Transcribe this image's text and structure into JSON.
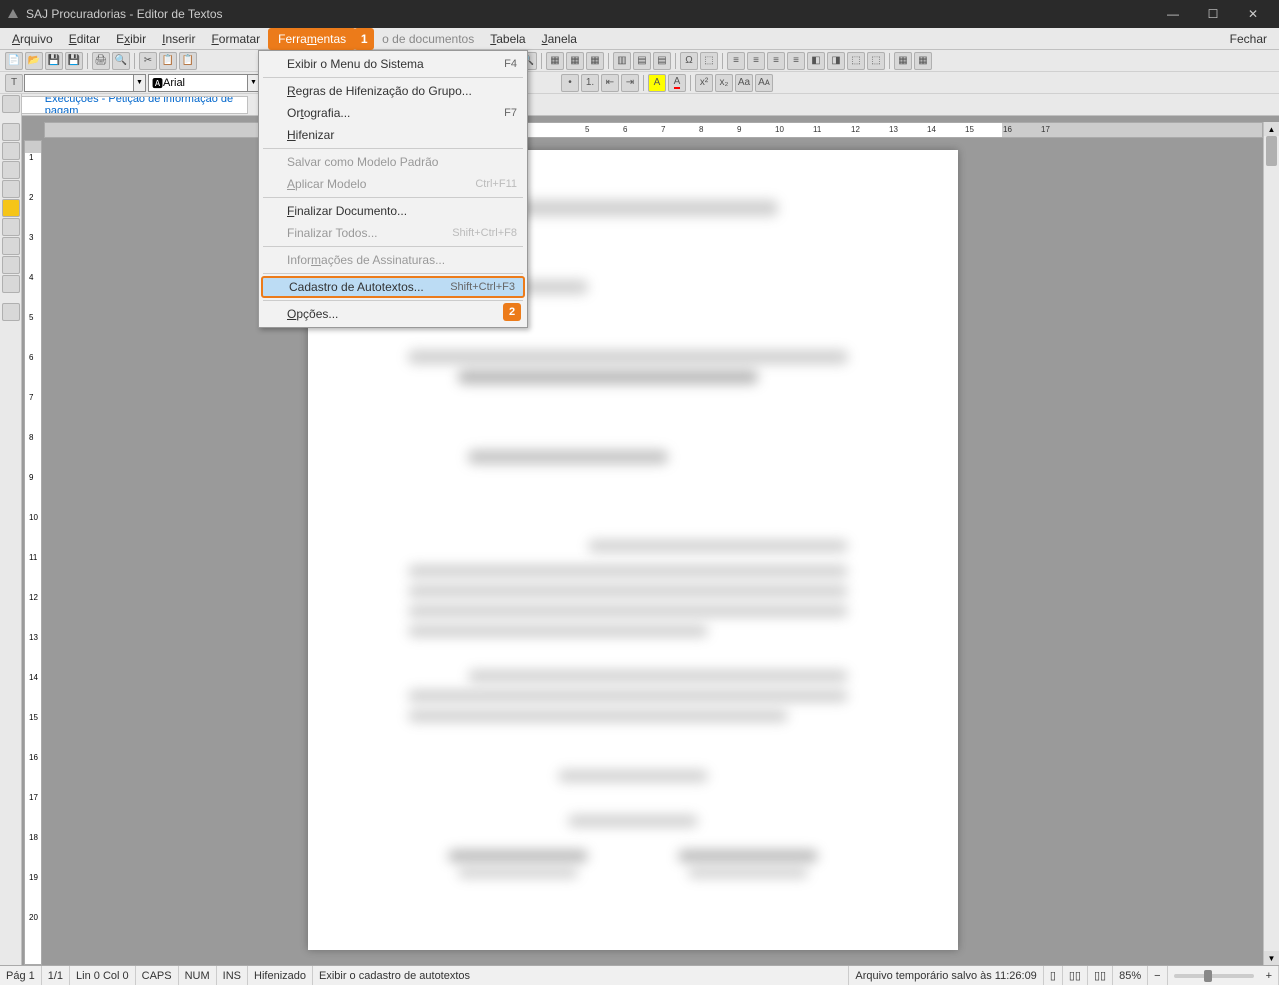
{
  "titlebar": {
    "title": "SAJ Procuradorias - Editor de Textos"
  },
  "menubar": {
    "items": [
      "Arquivo",
      "Editar",
      "Exibir",
      "Inserir",
      "Formatar",
      "Ferramentas",
      "o de documentos",
      "Tabela",
      "Janela"
    ],
    "selected_index": 5,
    "callout1": "1",
    "right": "Fechar"
  },
  "toolbar2": {
    "font": "Arial",
    "style": "",
    "size": ""
  },
  "breadcrumb": "Execuções - Petição de informação de pagam",
  "dropdown": {
    "items": [
      {
        "label": "Exibir o Menu do Sistema",
        "shortcut": "F4",
        "enabled": true
      },
      {
        "sep": true
      },
      {
        "label": "Regras de Hifenização do Grupo...",
        "shortcut": "",
        "enabled": true
      },
      {
        "label": "Ortografia...",
        "shortcut": "F7",
        "enabled": true
      },
      {
        "label": "Hifenizar",
        "shortcut": "",
        "enabled": true
      },
      {
        "sep": true
      },
      {
        "label": "Salvar como Modelo Padrão",
        "shortcut": "",
        "enabled": false
      },
      {
        "label": "Aplicar Modelo",
        "shortcut": "Ctrl+F11",
        "enabled": false
      },
      {
        "sep": true
      },
      {
        "label": "Finalizar Documento...",
        "shortcut": "",
        "enabled": true
      },
      {
        "label": "Finalizar Todos...",
        "shortcut": "Shift+Ctrl+F8",
        "enabled": false
      },
      {
        "sep": true
      },
      {
        "label": "Informações de Assinaturas...",
        "shortcut": "",
        "enabled": false
      },
      {
        "sep": true
      },
      {
        "label": "Cadastro de Autotextos...",
        "shortcut": "Shift+Ctrl+F3",
        "enabled": true,
        "highlighted": true
      },
      {
        "sep": true
      },
      {
        "label": "Opções...",
        "shortcut": "",
        "enabled": true
      }
    ],
    "callout2": "2"
  },
  "ruler": {
    "numbers": [
      "5",
      "6",
      "7",
      "8",
      "9",
      "10",
      "11",
      "12",
      "13",
      "14",
      "15",
      "16",
      "17"
    ]
  },
  "vruler": {
    "numbers": [
      "1",
      "2",
      "3",
      "4",
      "5",
      "6",
      "7",
      "8",
      "9",
      "10",
      "11",
      "12",
      "13",
      "14",
      "15",
      "16",
      "17",
      "18",
      "19",
      "20"
    ]
  },
  "statusbar": {
    "page": "Pág 1",
    "pages": "1/1",
    "pos": "Lin 0  Col 0",
    "caps": "CAPS",
    "num": "NUM",
    "ins": "INS",
    "hifen": "Hifenizado",
    "hint": "Exibir o cadastro de autotextos",
    "autosave": "Arquivo temporário salvo às 11:26:09",
    "zoom": "85%"
  }
}
